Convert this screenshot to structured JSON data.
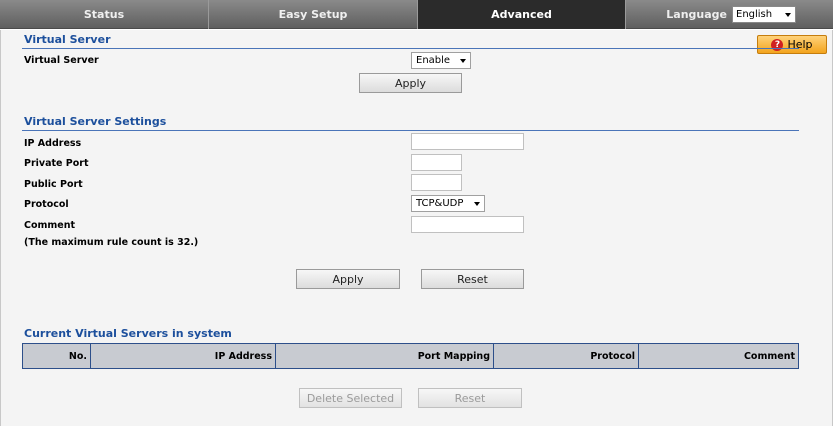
{
  "nav": {
    "tabs": [
      {
        "label": "Status"
      },
      {
        "label": "Easy Setup"
      },
      {
        "label": "Advanced"
      }
    ],
    "language_label": "Language",
    "language_value": "English"
  },
  "help": {
    "label": "Help"
  },
  "virtual_server": {
    "section_title": "Virtual Server",
    "field_label": "Virtual Server",
    "value": "Enable",
    "apply_label": "Apply"
  },
  "settings": {
    "section_title": "Virtual Server Settings",
    "ip_label": "IP Address",
    "ip_value": "",
    "private_port_label": "Private Port",
    "private_port_value": "",
    "public_port_label": "Public Port",
    "public_port_value": "",
    "protocol_label": "Protocol",
    "protocol_value": "TCP&UDP",
    "comment_label": "Comment",
    "comment_value": "",
    "max_note": "(The maximum rule count is 32.)",
    "apply_label": "Apply",
    "reset_label": "Reset"
  },
  "current": {
    "section_title": "Current Virtual Servers in system",
    "columns": [
      "No.",
      "IP Address",
      "Port Mapping",
      "Protocol",
      "Comment"
    ],
    "delete_label": "Delete Selected",
    "reset_label": "Reset"
  }
}
